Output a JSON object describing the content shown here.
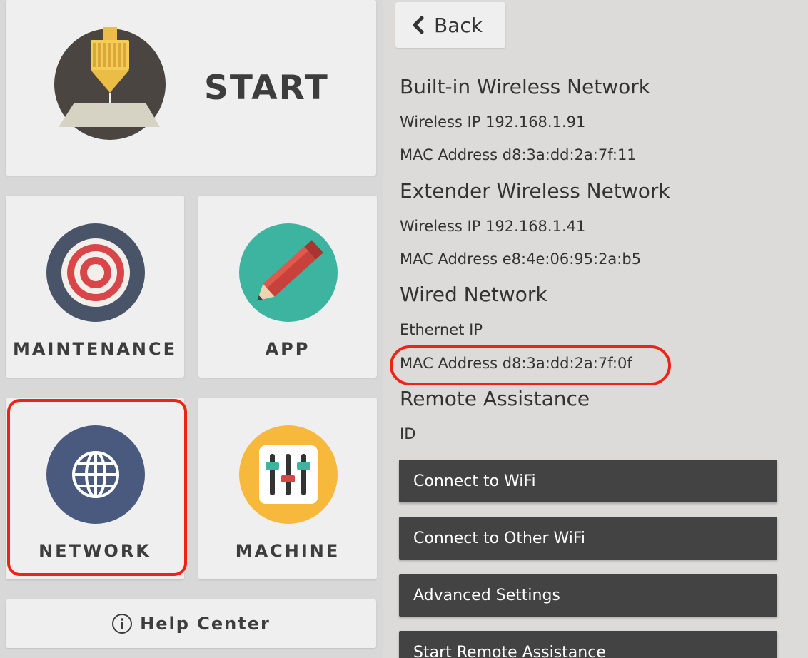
{
  "left": {
    "start_label": "START",
    "tiles": [
      {
        "label": "MAINTENANCE"
      },
      {
        "label": "APP"
      },
      {
        "label": "NETWORK"
      },
      {
        "label": "MACHINE"
      }
    ],
    "help_label": "Help Center"
  },
  "right": {
    "back_label": "Back",
    "builtin": {
      "title": "Built-in Wireless Network",
      "ip_line": "Wireless IP 192.168.1.91",
      "mac_line": "MAC Address d8:3a:dd:2a:7f:11"
    },
    "extender": {
      "title": "Extender Wireless Network",
      "ip_line": "Wireless IP 192.168.1.41",
      "mac_line": "MAC Address e8:4e:06:95:2a:b5"
    },
    "wired": {
      "title": "Wired Network",
      "ip_line": "Ethernet IP",
      "mac_line": "MAC Address d8:3a:dd:2a:7f:0f"
    },
    "remote": {
      "title": "Remote Assistance",
      "id_line": "ID"
    },
    "buttons": [
      {
        "label": "Connect to WiFi"
      },
      {
        "label": "Connect to Other WiFi"
      },
      {
        "label": "Advanced Settings"
      },
      {
        "label": "Start Remote Assistance"
      }
    ]
  },
  "colors": {
    "highlight": "#ec2415",
    "button_bg": "#434343",
    "network_icon_bg": "#495a7e",
    "app_icon_bg": "#3cb4a0",
    "machine_icon_bg": "#f7b93c"
  }
}
